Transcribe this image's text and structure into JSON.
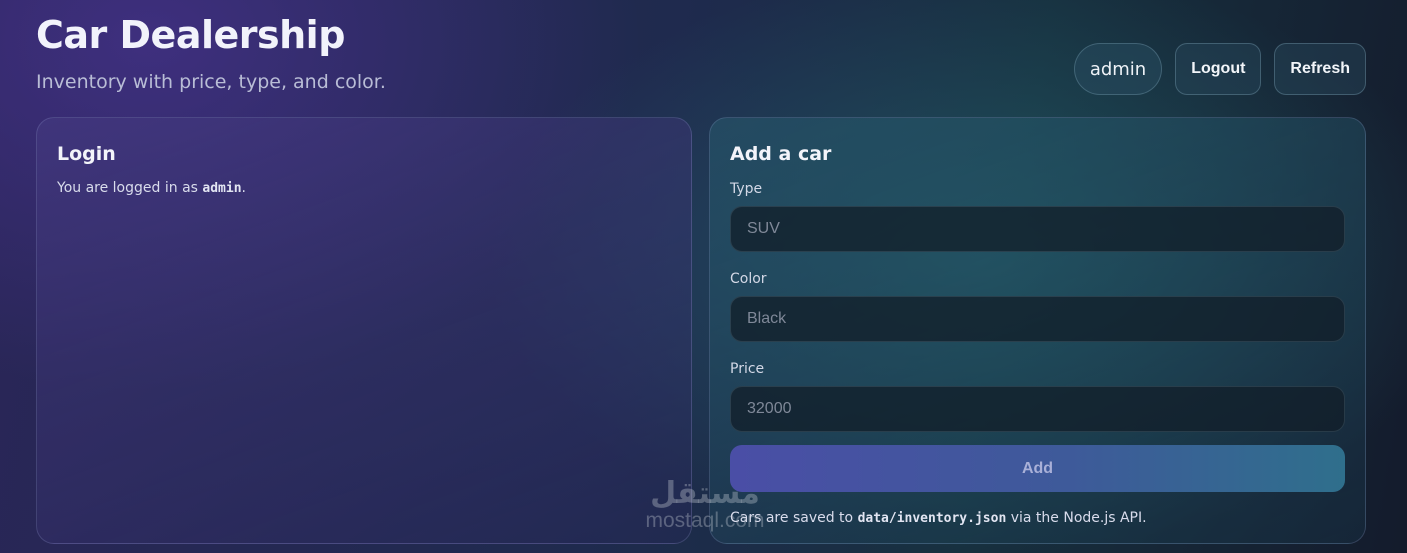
{
  "header": {
    "title": "Car Dealership",
    "subtitle": "Inventory with price, type, and color."
  },
  "top_actions": {
    "user": "admin",
    "logout_label": "Logout",
    "refresh_label": "Refresh"
  },
  "login_card": {
    "title": "Login",
    "text_prefix": "You are logged in as ",
    "username": "admin",
    "text_suffix": "."
  },
  "add_card": {
    "title": "Add a car",
    "type_label": "Type",
    "type_placeholder": "SUV",
    "color_label": "Color",
    "color_placeholder": "Black",
    "price_label": "Price",
    "price_placeholder": "32000",
    "add_label": "Add",
    "note_prefix": "Cars are saved to ",
    "note_path": "data/inventory.json",
    "note_suffix": " via the Node.js API."
  },
  "watermark": {
    "logo": "مستقل",
    "text": "mostaql.com"
  }
}
